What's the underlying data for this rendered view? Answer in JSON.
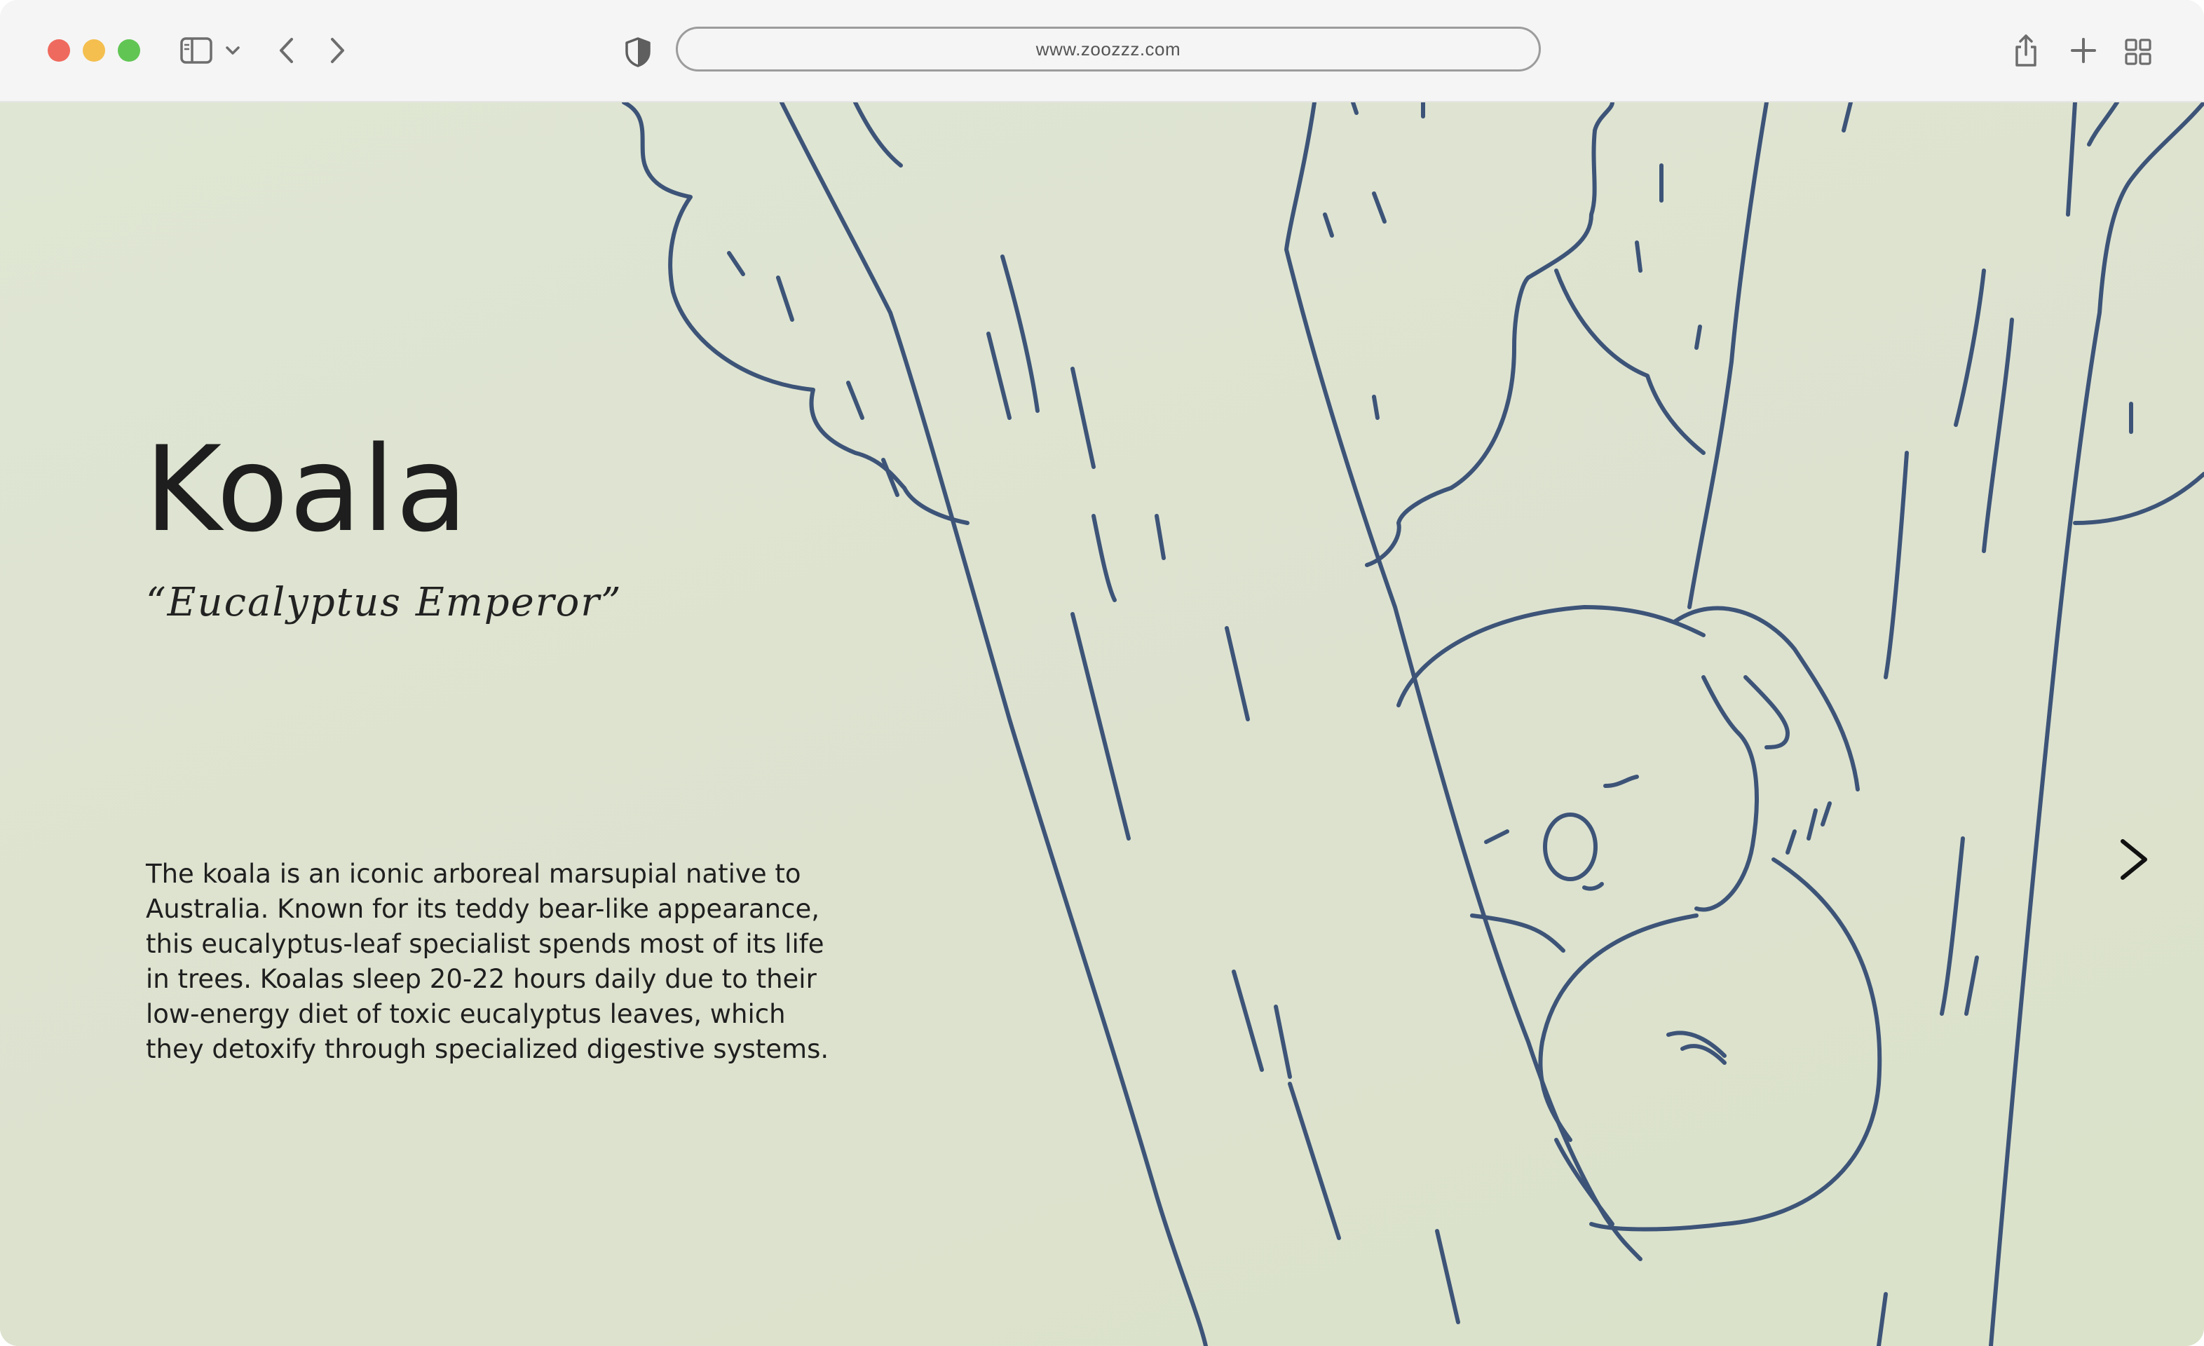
{
  "browser": {
    "url": "www.zoozzz.com",
    "traffic_lights": {
      "close": "#ef6a5e",
      "minimize": "#f4bf4f",
      "zoom": "#61c554"
    }
  },
  "page": {
    "title": "Koala",
    "subtitle": "“Eucalyptus Emperor”",
    "description": "The koala is an iconic arboreal marsupial native to Australia. Known for its teddy bear-like appearance, this eucalyptus-leaf specialist spends most of its life in trees. Koalas sleep 20-22 hours daily due to their low-energy diet of toxic eucalyptus leaves, which they detoxify through specialized digestive systems.",
    "colors": {
      "background": "#dfe5d2",
      "line_art": "#3d5478",
      "text": "#1e1e1e"
    }
  },
  "icons": {
    "sidebar": "sidebar-icon",
    "sidebar_menu": "chevron-down-icon",
    "back": "chevron-left-icon",
    "forward": "chevron-right-icon",
    "privacy": "shield-icon",
    "share": "share-icon",
    "new_tab": "plus-icon",
    "tab_overview": "grid-icon",
    "next": "arrow-right-icon"
  }
}
